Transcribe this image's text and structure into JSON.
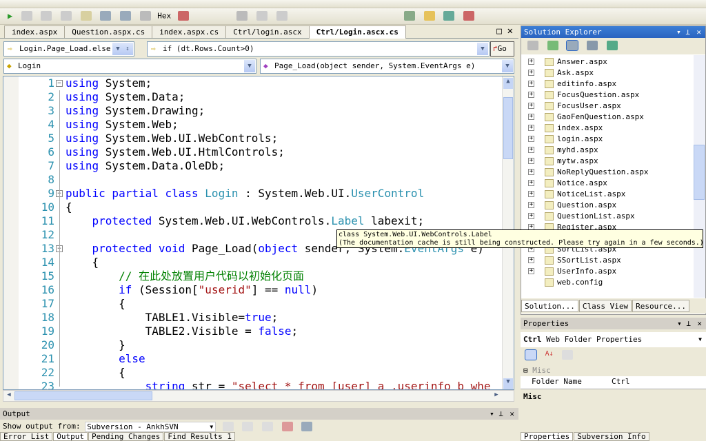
{
  "toolbar": {
    "hex_label": "Hex"
  },
  "tabs": [
    {
      "label": "index.aspx",
      "active": false
    },
    {
      "label": "Question.aspx.cs",
      "active": false
    },
    {
      "label": "index.aspx.cs",
      "active": false
    },
    {
      "label": "Ctrl/login.ascx",
      "active": false
    },
    {
      "label": "Ctrl/Login.ascx.cs",
      "active": true
    }
  ],
  "nav": {
    "scope": "Login.Page_Load.else.if",
    "statement": "if (dt.Rows.Count>0)",
    "go_label": "Go",
    "class_combo": "Login",
    "member_combo": "Page_Load(object sender, System.EventArgs e)"
  },
  "editor": {
    "lines": [
      {
        "n": "1",
        "t": [
          [
            "using ",
            "kw"
          ],
          [
            "System;",
            "pl"
          ]
        ]
      },
      {
        "n": "2",
        "t": [
          [
            "using ",
            "kw"
          ],
          [
            "System.Data;",
            "pl"
          ]
        ]
      },
      {
        "n": "3",
        "t": [
          [
            "using ",
            "kw"
          ],
          [
            "System.Drawing;",
            "pl"
          ]
        ]
      },
      {
        "n": "4",
        "t": [
          [
            "using ",
            "kw"
          ],
          [
            "System.Web;",
            "pl"
          ]
        ]
      },
      {
        "n": "5",
        "t": [
          [
            "using ",
            "kw"
          ],
          [
            "System.Web.UI.WebControls;",
            "pl"
          ]
        ]
      },
      {
        "n": "6",
        "t": [
          [
            "using ",
            "kw"
          ],
          [
            "System.Web.UI.HtmlControls;",
            "pl"
          ]
        ]
      },
      {
        "n": "7",
        "t": [
          [
            "using ",
            "kw"
          ],
          [
            "System.Data.OleDb;",
            "pl"
          ]
        ]
      },
      {
        "n": "8",
        "t": []
      },
      {
        "n": "9",
        "t": [
          [
            "public partial class ",
            "kw"
          ],
          [
            "Login",
            "ty"
          ],
          [
            " : System.Web.UI.",
            "pl"
          ],
          [
            "UserControl",
            "ty"
          ]
        ]
      },
      {
        "n": "10",
        "t": [
          [
            "{",
            "pl"
          ]
        ]
      },
      {
        "n": "11",
        "t": [
          [
            "    protected ",
            "kw"
          ],
          [
            "System.Web.UI.WebControls.",
            "pl"
          ],
          [
            "Label",
            "ty"
          ],
          [
            " labexit;",
            "pl"
          ]
        ]
      },
      {
        "n": "12",
        "t": []
      },
      {
        "n": "13",
        "t": [
          [
            "    protected void ",
            "kw"
          ],
          [
            "Page_Load(",
            "pl"
          ],
          [
            "object ",
            "kw"
          ],
          [
            "sender, System.",
            "pl"
          ],
          [
            "EventArgs",
            "ty"
          ],
          [
            " e)",
            "pl"
          ]
        ]
      },
      {
        "n": "14",
        "t": [
          [
            "    {",
            "pl"
          ]
        ]
      },
      {
        "n": "15",
        "t": [
          [
            "        // 在此处放置用户代码以初始化页面",
            "cm"
          ]
        ]
      },
      {
        "n": "16",
        "t": [
          [
            "        if ",
            "kw"
          ],
          [
            "(Session[",
            "pl"
          ],
          [
            "\"userid\"",
            "st"
          ],
          [
            "] == ",
            "pl"
          ],
          [
            "null",
            "kw"
          ],
          [
            ")",
            "pl"
          ]
        ]
      },
      {
        "n": "17",
        "t": [
          [
            "        {",
            "pl"
          ]
        ]
      },
      {
        "n": "18",
        "t": [
          [
            "            TABLE1.Visible=",
            "pl"
          ],
          [
            "true",
            "kw"
          ],
          [
            ";",
            "pl"
          ]
        ]
      },
      {
        "n": "19",
        "t": [
          [
            "            TABLE2.Visible = ",
            "pl"
          ],
          [
            "false",
            "kw"
          ],
          [
            ";",
            "pl"
          ]
        ]
      },
      {
        "n": "20",
        "t": [
          [
            "        }",
            "pl"
          ]
        ]
      },
      {
        "n": "21",
        "t": [
          [
            "        else",
            "kw"
          ]
        ]
      },
      {
        "n": "22",
        "t": [
          [
            "        {",
            "pl"
          ]
        ]
      },
      {
        "n": "23",
        "t": [
          [
            "            string ",
            "kw"
          ],
          [
            "str = ",
            "pl"
          ],
          [
            "\"select * from [user] a ,userinfo b whe",
            "st"
          ]
        ]
      }
    ]
  },
  "tooltip": {
    "line1": "class System.Web.UI.WebControls.Label",
    "line2": "(The documentation cache is still being constructed. Please try again in a few seconds.)"
  },
  "output": {
    "title": "Output",
    "show_from_label": "Show output from:",
    "source": "Subversion - AnkhSVN",
    "tabs": [
      "Error List",
      "Output",
      "Pending Changes",
      "Find Results 1"
    ]
  },
  "solution_explorer": {
    "title": "Solution Explorer",
    "items_before": [
      "Answer.aspx",
      "Ask.aspx",
      "editinfo.aspx",
      "FocusQuestion.aspx",
      "FocusUser.aspx",
      "GaoFenQuestion.aspx",
      "index.aspx",
      "login.aspx",
      "myhd.aspx",
      "mytw.aspx",
      "NoReplyQuestion.aspx",
      "Notice.aspx",
      "NoticeList.aspx",
      "Question.aspx",
      "QuestionList.aspx",
      "Register.aspx"
    ],
    "items_after": [
      "SortList.aspx",
      "SSortList.aspx",
      "UserInfo.aspx"
    ],
    "config_item": "web.config",
    "tabs": [
      "Solution...",
      "Class View",
      "Resource..."
    ]
  },
  "properties": {
    "title": "Properties",
    "object_bold": "Ctrl",
    "object_desc": "Web Folder Properties",
    "category": "Misc",
    "rows": [
      {
        "name": "Folder Name",
        "value": "Ctrl"
      }
    ],
    "description_title": "Misc",
    "tabs": [
      "Properties",
      "Subversion Info"
    ]
  }
}
